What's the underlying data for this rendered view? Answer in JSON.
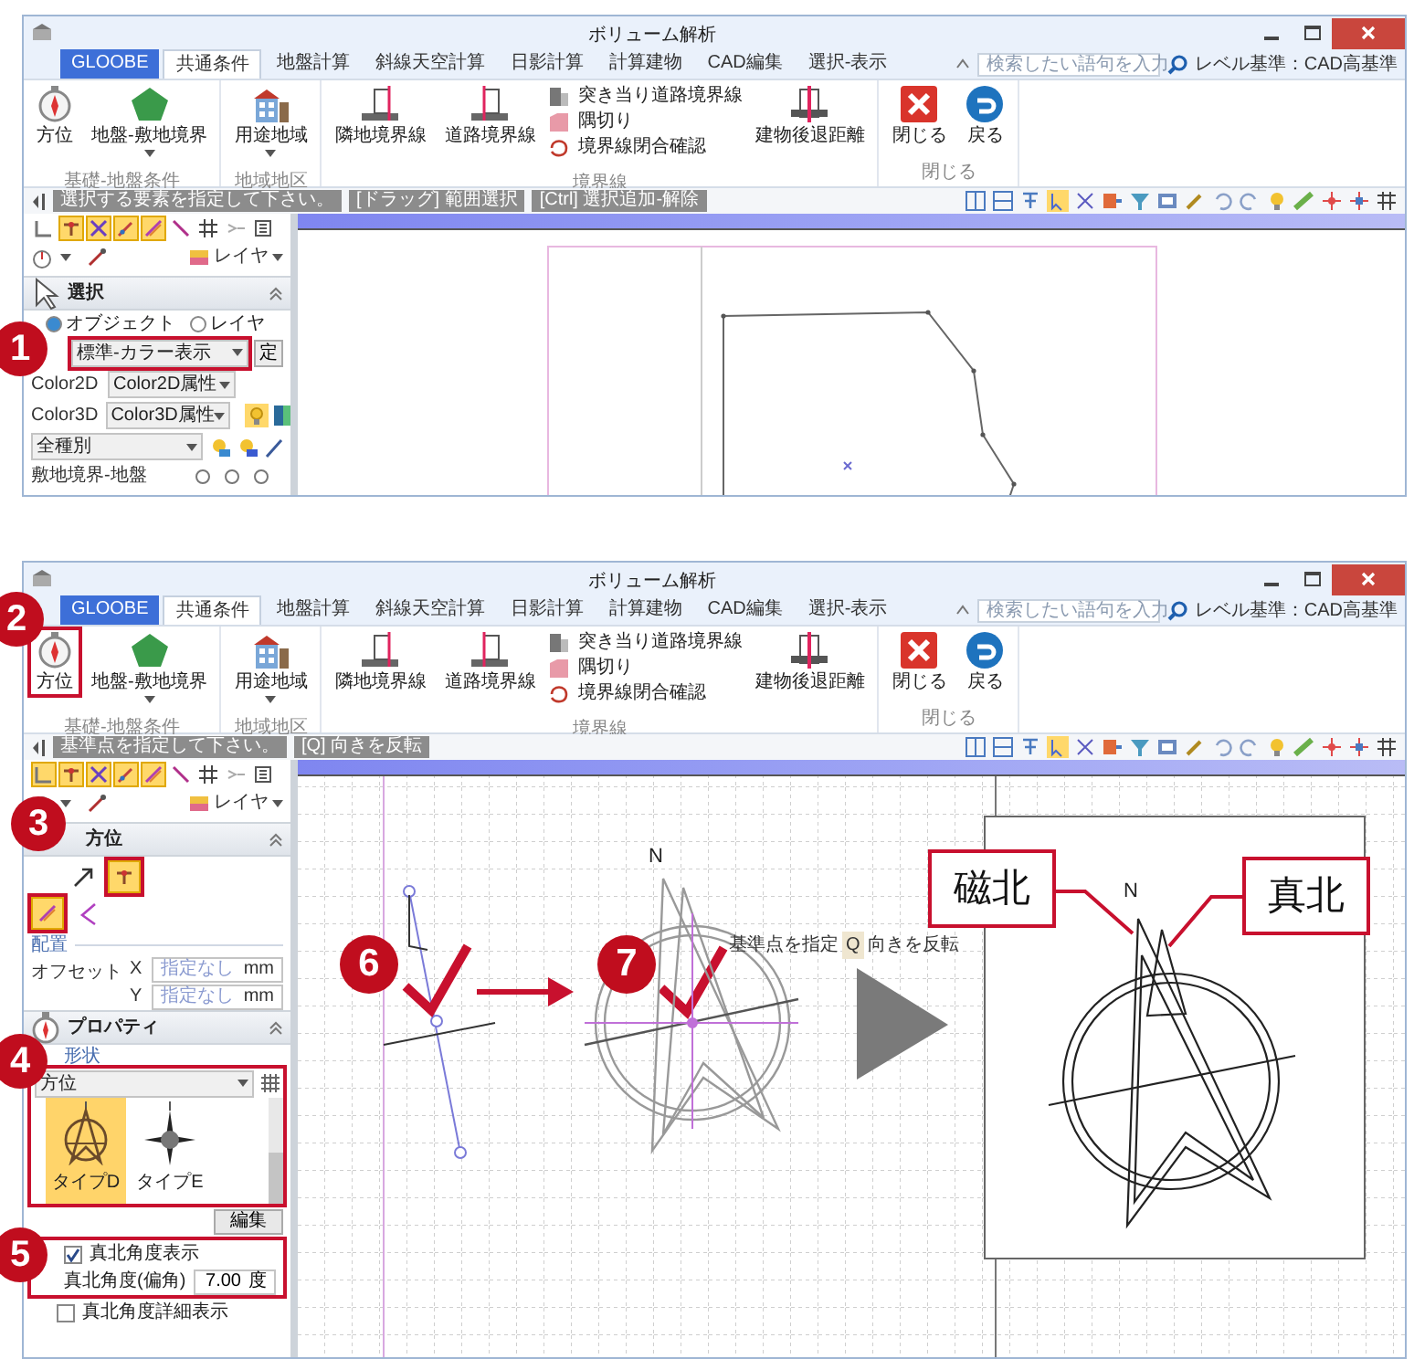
{
  "screens": [
    {
      "title": "ボリューム解析",
      "tabs": [
        {
          "label": "GLOOBE",
          "kind": "app",
          "selected": false
        },
        {
          "label": "共通条件",
          "kind": "tab",
          "selected": true
        },
        {
          "label": "地盤計算",
          "kind": "tab",
          "selected": false
        },
        {
          "label": "斜線天空計算",
          "kind": "tab",
          "selected": false
        },
        {
          "label": "日影計算",
          "kind": "tab",
          "selected": false
        },
        {
          "label": "計算建物",
          "kind": "tab",
          "selected": false
        },
        {
          "label": "CAD編集",
          "kind": "tab",
          "selected": false
        },
        {
          "label": "選択-表示",
          "kind": "tab",
          "selected": false
        }
      ],
      "search": {
        "placeholder": "検索したい語句を入力"
      },
      "level_label": "レベル基準：CAD高基準",
      "ribbon": [
        {
          "label": "基礎-地盤条件",
          "buttons": [
            {
              "kind": "compass",
              "label": "方位",
              "dropdown": false
            },
            {
              "kind": "pentagon",
              "label": "地盤-敷地境界",
              "dropdown": true
            }
          ]
        },
        {
          "label": "地域地区",
          "buttons": [
            {
              "kind": "building",
              "label": "用途地域",
              "dropdown": true
            }
          ]
        },
        {
          "label": "境界線",
          "buttons": [
            {
              "kind": "boundary",
              "label": "隣地境界線",
              "dropdown": false
            },
            {
              "kind": "road",
              "label": "道路境界線",
              "dropdown": false
            },
            {
              "kind": "stack",
              "items": [
                {
                  "kind": "square",
                  "label": "突き当り道路境界線"
                },
                {
                  "kind": "corner",
                  "label": "隅切り"
                },
                {
                  "kind": "check",
                  "label": "境界線閉合確認"
                }
              ]
            },
            {
              "kind": "setback",
              "label": "建物後退距離",
              "dropdown": false
            }
          ]
        },
        {
          "label": "閉じる",
          "buttons": [
            {
              "kind": "close",
              "label": "閉じる",
              "dropdown": false
            },
            {
              "kind": "back",
              "label": "戻る",
              "dropdown": false
            }
          ]
        }
      ],
      "prompts": [
        "選択する要素を指定して下さい。",
        "[ドラッグ] 範囲選択",
        "[Ctrl] 選択追加-解除"
      ],
      "snap_tools": [
        {
          "kind": "corner",
          "selected": false
        },
        {
          "kind": "point",
          "selected": true
        },
        {
          "kind": "cross",
          "selected": true
        },
        {
          "kind": "pen",
          "selected": true
        },
        {
          "kind": "slash",
          "selected": true
        },
        {
          "kind": "line",
          "selected": false
        },
        {
          "kind": "grid",
          "selected": false
        },
        {
          "kind": "dash",
          "selected": false
        },
        {
          "kind": "ruler",
          "selected": false
        }
      ],
      "layer_button": "レイヤ",
      "select_panel": {
        "title": "選択",
        "modes": [
          {
            "label": "オブジェクト",
            "selected": true
          },
          {
            "label": "レイヤ",
            "selected": false
          }
        ],
        "display_select": "標準-カラー表示",
        "set_button": "定",
        "rows": [
          {
            "label": "Color2D",
            "value": "Color2D属性"
          },
          {
            "label": "Color3D",
            "value": "Color3D属性"
          }
        ],
        "type_select": "全種別",
        "site_row": "敷地境界-地盤"
      },
      "canvas": {
        "kind": "site"
      },
      "steps": [
        "1"
      ]
    },
    {
      "title": "ボリューム解析",
      "tabs": [
        {
          "label": "GLOOBE",
          "kind": "app",
          "selected": false
        },
        {
          "label": "共通条件",
          "kind": "tab",
          "selected": true
        },
        {
          "label": "地盤計算",
          "kind": "tab",
          "selected": false
        },
        {
          "label": "斜線天空計算",
          "kind": "tab",
          "selected": false
        },
        {
          "label": "日影計算",
          "kind": "tab",
          "selected": false
        },
        {
          "label": "計算建物",
          "kind": "tab",
          "selected": false
        },
        {
          "label": "CAD編集",
          "kind": "tab",
          "selected": false
        },
        {
          "label": "選択-表示",
          "kind": "tab",
          "selected": false
        }
      ],
      "search": {
        "placeholder": "検索したい語句を入力"
      },
      "level_label": "レベル基準：CAD高基準",
      "ribbon": [
        {
          "label": "基礎-地盤条件",
          "buttons": [
            {
              "kind": "compass",
              "label": "方位",
              "dropdown": false
            },
            {
              "kind": "pentagon",
              "label": "地盤-敷地境界",
              "dropdown": true
            }
          ]
        },
        {
          "label": "地域地区",
          "buttons": [
            {
              "kind": "building",
              "label": "用途地域",
              "dropdown": true
            }
          ]
        },
        {
          "label": "境界線",
          "buttons": [
            {
              "kind": "boundary",
              "label": "隣地境界線",
              "dropdown": false
            },
            {
              "kind": "road",
              "label": "道路境界線",
              "dropdown": false
            },
            {
              "kind": "stack",
              "items": [
                {
                  "kind": "square",
                  "label": "突き当り道路境界線"
                },
                {
                  "kind": "corner",
                  "label": "隅切り"
                },
                {
                  "kind": "check",
                  "label": "境界線閉合確認"
                }
              ]
            },
            {
              "kind": "setback",
              "label": "建物後退距離",
              "dropdown": false
            }
          ]
        },
        {
          "label": "閉じる",
          "buttons": [
            {
              "kind": "close",
              "label": "閉じる",
              "dropdown": false
            },
            {
              "kind": "back",
              "label": "戻る",
              "dropdown": false
            }
          ]
        }
      ],
      "prompts": [
        "基準点を指定して下さい。",
        "[Q] 向きを反転"
      ],
      "snap_tools": [
        {
          "kind": "corner",
          "selected": true
        },
        {
          "kind": "point",
          "selected": true
        },
        {
          "kind": "cross",
          "selected": true
        },
        {
          "kind": "pen",
          "selected": true
        },
        {
          "kind": "slash",
          "selected": true
        },
        {
          "kind": "line",
          "selected": false
        },
        {
          "kind": "grid",
          "selected": false
        },
        {
          "kind": "dash",
          "selected": false
        },
        {
          "kind": "ruler",
          "selected": false
        }
      ],
      "layer_button": "レイヤ",
      "orientation_panel": {
        "title": "方位",
        "tools": [
          {
            "kind": "arrow",
            "selected": false
          },
          {
            "kind": "point",
            "selected": true
          },
          {
            "kind": "slash",
            "selected": true
          },
          {
            "kind": "angle",
            "selected": false
          }
        ],
        "placement_label": "配置",
        "fields": [
          {
            "label": "オフセット",
            "axis": "X",
            "placeholder": "指定なし",
            "unit": "mm"
          },
          {
            "axis": "Y",
            "placeholder": "指定なし",
            "unit": "mm"
          }
        ]
      },
      "property_panel": {
        "title": "プロパティ",
        "shape_label": "形状",
        "shape_select": "方位",
        "types": [
          {
            "label": "タイプD",
            "kind": "ring",
            "selected": true
          },
          {
            "label": "タイプE",
            "kind": "star",
            "selected": false
          }
        ],
        "edit_button": "編集",
        "items": [
          {
            "kind": "check",
            "label": "真北角度表示",
            "checked": true
          },
          {
            "kind": "field",
            "label": "真北角度(偏角)",
            "value": "7.00",
            "unit": "度"
          },
          {
            "kind": "check",
            "label": "真北角度詳細表示",
            "checked": false
          }
        ]
      },
      "canvas": {
        "kind": "placement",
        "north_labels": [
          "N",
          "N"
        ],
        "tooltip": [
          "基準点を指定",
          "Q",
          "向きを反転"
        ],
        "callouts": [
          "磁北",
          "真北"
        ]
      },
      "steps": [
        "2",
        "3",
        "4",
        "5",
        "6",
        "7"
      ]
    }
  ]
}
